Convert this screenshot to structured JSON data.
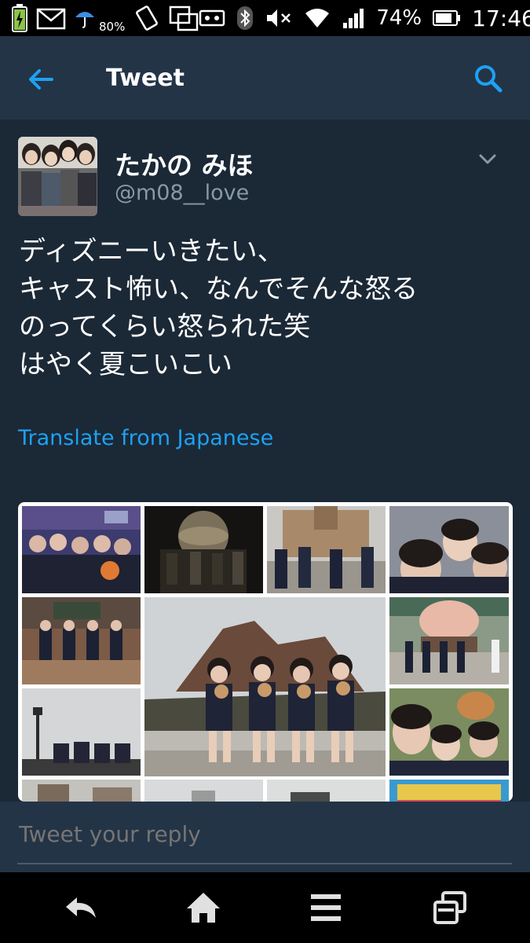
{
  "status_bar": {
    "notify_percent": "80%",
    "battery_percent": "74%",
    "time": "17:46"
  },
  "app_bar": {
    "title": "Tweet"
  },
  "tweet": {
    "display_name": "たかの みほ",
    "handle": "@m08__love",
    "text_lines": [
      "ディズニーいきたい、",
      "キャスト怖い、なんでそんな怒る",
      "のってくらい怒られた笑",
      "はやく夏こいこい"
    ],
    "translate_label": "Translate from Japanese"
  },
  "reply": {
    "placeholder": "Tweet your reply"
  },
  "icons": {
    "back": "arrow-left-icon",
    "search": "search-icon",
    "more": "chevron-down-icon",
    "nav_back": "back-arrow-icon",
    "nav_home": "home-icon",
    "nav_menu": "menu-icon",
    "nav_recents": "recent-apps-icon"
  },
  "colors": {
    "background": "#1b2836",
    "app_bar": "#243447",
    "accent": "#1da1f2",
    "secondary_text": "#8899a6"
  }
}
